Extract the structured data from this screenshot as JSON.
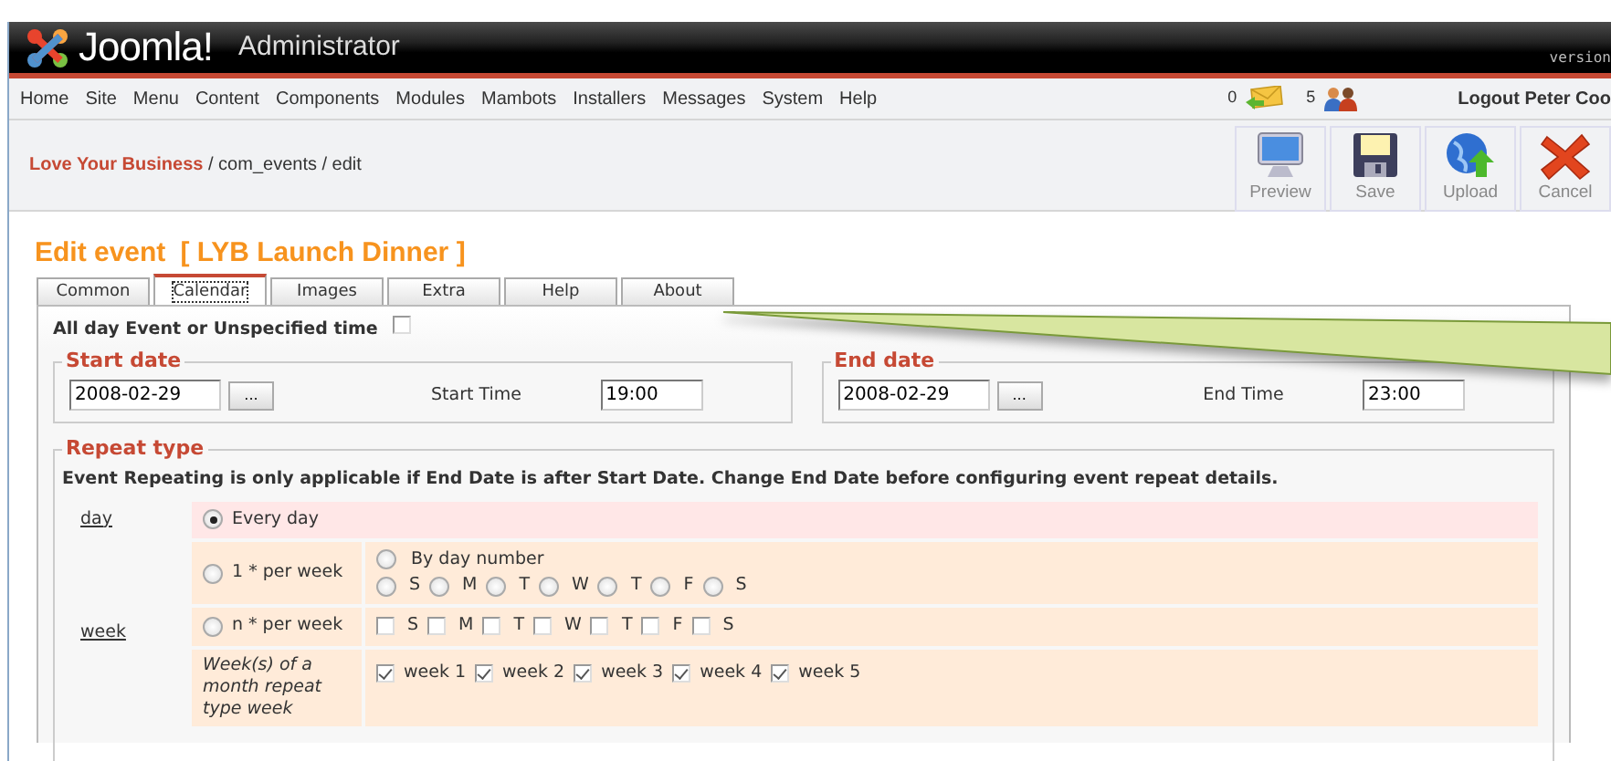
{
  "header": {
    "logo": "Joomla!",
    "title": "Administrator",
    "version": "version"
  },
  "menu": [
    "Home",
    "Site",
    "Menu",
    "Content",
    "Components",
    "Modules",
    "Mambots",
    "Installers",
    "Messages",
    "System",
    "Help"
  ],
  "status": {
    "messages": "0",
    "users": "5",
    "logout": "Logout Peter Coo"
  },
  "breadcrumb": {
    "site": "Love Your Business",
    "path": "/ com_events / edit"
  },
  "toolbar": [
    {
      "label": "Preview",
      "kind": "preview"
    },
    {
      "label": "Save",
      "kind": "save"
    },
    {
      "label": "Upload",
      "kind": "upload"
    },
    {
      "label": "Cancel",
      "kind": "cancel"
    }
  ],
  "page_title": {
    "text": "Edit event",
    "item": "[ LYB Launch Dinner ]"
  },
  "tabs": [
    {
      "label": "Common",
      "selected": false
    },
    {
      "label": "Calendar",
      "selected": true
    },
    {
      "label": "Images",
      "selected": false
    },
    {
      "label": "Extra",
      "selected": false
    },
    {
      "label": "Help",
      "selected": false
    },
    {
      "label": "About",
      "selected": false
    }
  ],
  "all_day": {
    "label": "All day Event or Unspecified time",
    "checked": false
  },
  "start": {
    "legend": "Start date",
    "date": "2008-02-29",
    "picker": "...",
    "time_label": "Start Time",
    "time": "19:00"
  },
  "end": {
    "legend": "End date",
    "date": "2008-02-29",
    "picker": "...",
    "time_label": "End Time",
    "time": "23:00"
  },
  "repeat": {
    "legend": "Repeat type",
    "note": "Event Repeating is only applicable if End Date is after Start Date. Change End Date before configuring event repeat details.",
    "day_label": "day",
    "week_label": "week",
    "every_day": {
      "label": "Every day",
      "selected": true
    },
    "once_per_week": {
      "label": "1 * per week",
      "selected": false,
      "by_day": {
        "label": "By day number",
        "selected": false
      },
      "days": [
        {
          "label": "S",
          "selected": false
        },
        {
          "label": "M",
          "selected": false
        },
        {
          "label": "T",
          "selected": false
        },
        {
          "label": "W",
          "selected": false
        },
        {
          "label": "T",
          "selected": false
        },
        {
          "label": "F",
          "selected": false
        },
        {
          "label": "S",
          "selected": false
        }
      ]
    },
    "n_per_week": {
      "label": "n * per week",
      "selected": false,
      "days": [
        {
          "label": "S",
          "checked": false
        },
        {
          "label": "M",
          "checked": false
        },
        {
          "label": "T",
          "checked": false
        },
        {
          "label": "W",
          "checked": false
        },
        {
          "label": "T",
          "checked": false
        },
        {
          "label": "F",
          "checked": false
        },
        {
          "label": "S",
          "checked": false
        }
      ]
    },
    "weeks_of_month": {
      "label": "Week(s) of a month repeat type week",
      "weeks": [
        {
          "label": "week 1",
          "checked": true
        },
        {
          "label": "week 2",
          "checked": true
        },
        {
          "label": "week 3",
          "checked": true
        },
        {
          "label": "week 4",
          "checked": true
        },
        {
          "label": "week 5",
          "checked": true
        }
      ]
    }
  }
}
